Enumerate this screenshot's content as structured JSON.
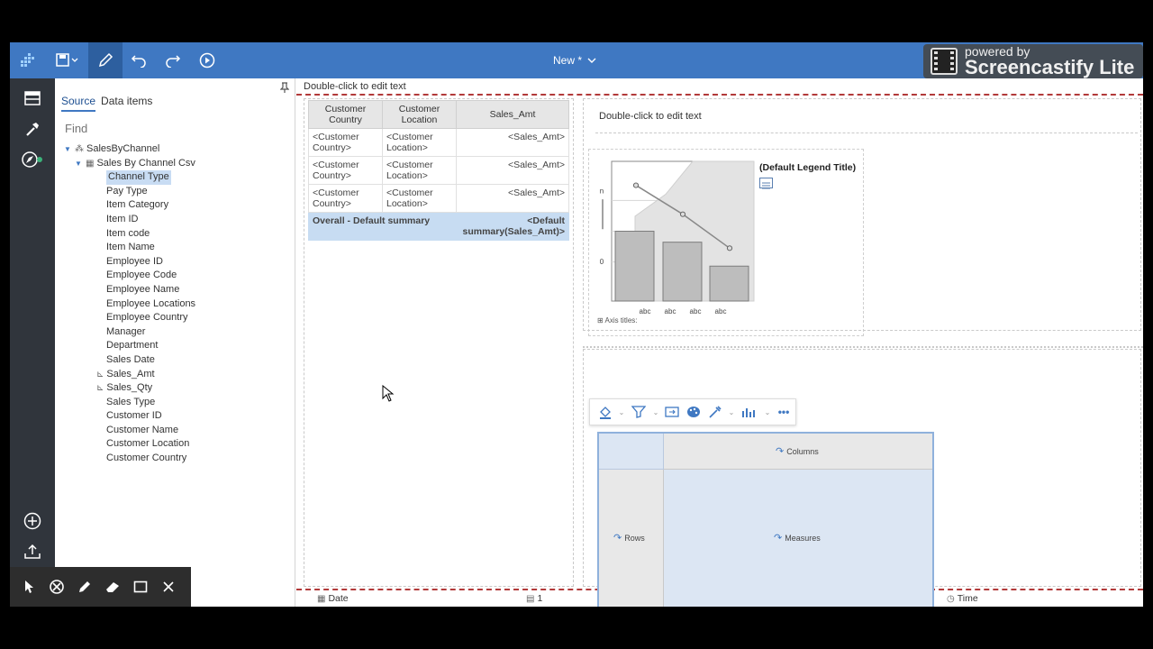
{
  "topbar": {
    "doc_title": "New *",
    "watermark_line1": "powered by",
    "watermark_line2": "Screencastify Lite"
  },
  "source_panel": {
    "tabs": [
      "Source",
      "Data items"
    ],
    "find_placeholder": "Find",
    "package": "SalesByChannel",
    "query_subject": "Sales By Channel Csv",
    "items": [
      "Channel Type",
      "Pay Type",
      "Item Category",
      "Item ID",
      "Item code",
      "Item Name",
      "Employee ID",
      "Employee Code",
      "Employee Name",
      "Employee Locations",
      "Employee Country",
      "Manager",
      "Department",
      "Sales Date",
      "Sales_Amt",
      "Sales_Qty",
      "Sales Type",
      "Customer ID",
      "Customer Name",
      "Customer Location",
      "Customer Country"
    ],
    "selected_item": "Channel Type",
    "measure_items": [
      "Sales_Amt",
      "Sales_Qty"
    ]
  },
  "report": {
    "header_text": "Double-click to edit text",
    "chart_text": "Double-click to edit text",
    "list": {
      "headers": [
        "Customer Country",
        "Customer Location",
        "Sales_Amt"
      ],
      "rows": [
        [
          "<Customer Country>",
          "<Customer Location>",
          "<Sales_Amt>"
        ],
        [
          "<Customer Country>",
          "<Customer Location>",
          "<Sales_Amt>"
        ],
        [
          "<Customer Country>",
          "<Customer Location>",
          "<Sales_Amt>"
        ]
      ],
      "summary_label": "Overall  -  Default summary",
      "summary_value": "<Default summary(Sales_Amt)>"
    },
    "chart": {
      "legend_title": "(Default Legend Title)",
      "axis_titles_label": "Axis titles:",
      "y_tick_top": "n",
      "y_tick_zero": "0"
    },
    "crosstab": {
      "columns_label": "Columns",
      "rows_label": "Rows",
      "measures_label": "Measures"
    },
    "footer": {
      "date": "Date",
      "page": "1",
      "time": "Time"
    }
  },
  "chart_data": {
    "type": "bar",
    "categories": [
      "abc",
      "abc",
      "abc",
      "abc"
    ],
    "series": [
      {
        "kind": "bar",
        "values": [
          0.7,
          0.59,
          0.35
        ]
      },
      {
        "kind": "line",
        "values": [
          1.16,
          0.87,
          0.53
        ]
      },
      {
        "kind": "area",
        "values": [
          0.85,
          1.07,
          1.4,
          1.4
        ]
      }
    ],
    "ylim": [
      0,
      1.4
    ],
    "placeholder": true
  },
  "colors": {
    "topbar": "#3f78c2",
    "rail": "#30353c",
    "selection": "#c7dcf2",
    "dashed_border": "#b23a3a"
  }
}
